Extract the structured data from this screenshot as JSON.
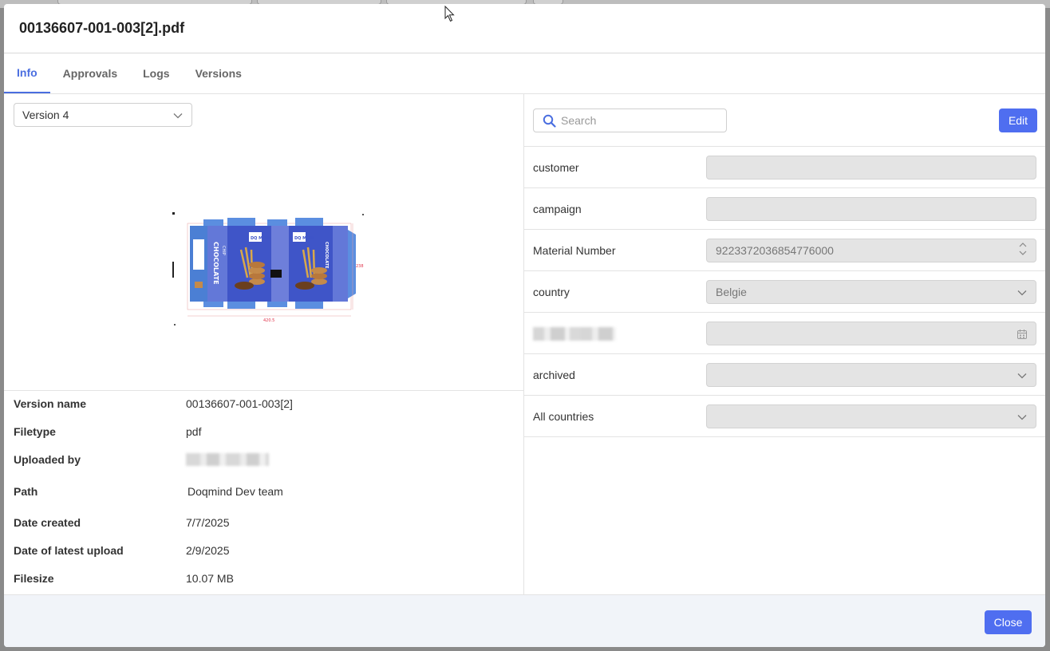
{
  "modal": {
    "title": "00136607-001-003[2].pdf"
  },
  "tabs": [
    {
      "label": "Info",
      "active": true
    },
    {
      "label": "Approvals"
    },
    {
      "label": "Logs"
    },
    {
      "label": "Versions"
    }
  ],
  "version_select": {
    "value": "Version 4",
    "icon": "chevron-down-icon"
  },
  "preview": {
    "product_text": "CHOCOLATE",
    "sub_text": "CHIP",
    "brand": "DQ MIND",
    "dimension_width": "420.5",
    "dimension_height": "238"
  },
  "info": [
    {
      "label": "Version name",
      "value": "00136607-001-003[2]"
    },
    {
      "label": "Filetype",
      "value": "pdf"
    },
    {
      "label": "Uploaded by",
      "value": ""
    },
    {
      "label": "Path",
      "value": "Doqmind Dev team"
    },
    {
      "label": "Date created",
      "value": "7/7/2025"
    },
    {
      "label": "Date of latest upload",
      "value": "2/9/2025"
    },
    {
      "label": "Filesize",
      "value": "10.07 MB"
    }
  ],
  "search": {
    "placeholder": "Search",
    "icon": "search-icon"
  },
  "edit_button": {
    "label": "Edit"
  },
  "fields": [
    {
      "label": "customer",
      "value": ""
    },
    {
      "label": "campaign",
      "value": ""
    },
    {
      "label": "Material Number",
      "value": "9223372036854776000",
      "kind": "number"
    },
    {
      "label": "country",
      "value": "Belgie",
      "kind": "select"
    },
    {
      "label": "",
      "value": "",
      "kind": "date"
    },
    {
      "label": "archived",
      "value": "",
      "kind": "select"
    },
    {
      "label": "All countries",
      "value": "",
      "kind": "select"
    }
  ],
  "footer": {
    "close_label": "Close"
  },
  "colors": {
    "accent": "#4f6ef0",
    "tab_active": "#4a6ee0",
    "footer_bg": "#f1f4f9",
    "field_bg": "#e4e4e4"
  }
}
